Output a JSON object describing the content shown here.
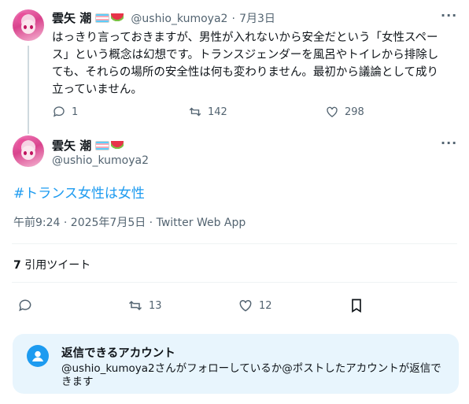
{
  "parent_tweet": {
    "display_name": "雲矢 潮",
    "handle": "@ushio_kumoya2",
    "separator": "·",
    "date": "7月3日",
    "text_lines": [
      "はっきり言っておきますが、男性が入れないから安全だという「女性スペー",
      "ス」という概念は幻想です。トランスジェンダーを風呂やトイレから排除し",
      "ても、それらの場所の安全性は何も変わりません。最初から議論として成り",
      "立っていません。"
    ],
    "reply_count": "1",
    "retweet_count": "142",
    "like_count": "298"
  },
  "main_tweet": {
    "display_name": "雲矢 潮",
    "handle": "@ushio_kumoya2",
    "text": "#トランス女性は女性",
    "timestamp": "午前9:24 · 2025年7月5日 · Twitter Web App",
    "quotes_count": "7",
    "quotes_label": "引用ツイート",
    "retweet_count": "13",
    "like_count": "12"
  },
  "reply_restriction": {
    "title": "返信できるアカウント",
    "description_line1": "@ushio_kumoya2さんがフォローしているか@ポストしたアカウントが返信で",
    "description_line2": "きます"
  },
  "icons": {
    "more": "more-horizontal-icon",
    "reply": "reply-icon",
    "retweet": "retweet-icon",
    "like": "heart-icon",
    "bookmark": "bookmark-icon",
    "mention": "at-mention-icon"
  },
  "colors": {
    "accent": "#1d9bf0",
    "secondary_text": "#536471",
    "reply_box_bg": "#e8f5fd"
  }
}
